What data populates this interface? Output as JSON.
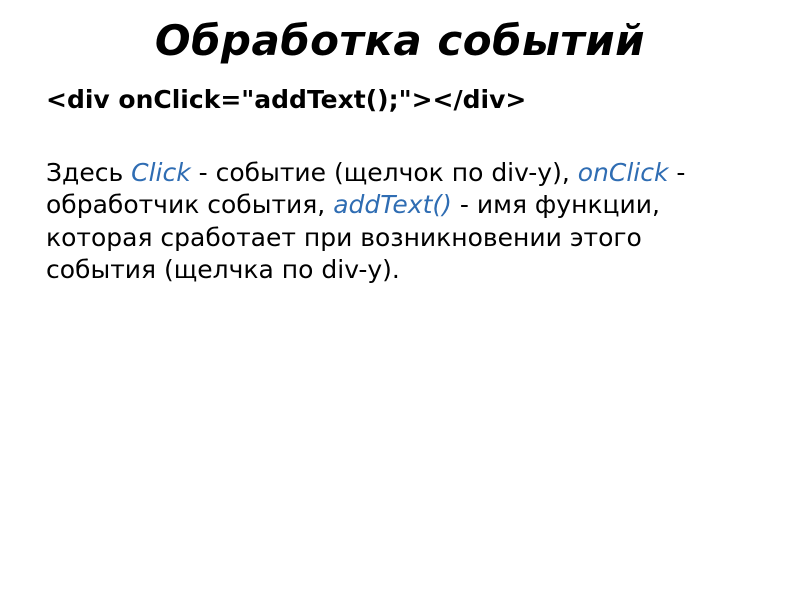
{
  "title": "Обработка событий",
  "code_line": "<div onClick=\"addText();\"></div>",
  "body": {
    "p1_before_click": "Здесь ",
    "click": "Click",
    "p1_after_click": " - событие (щелчок по div-у), ",
    "onclick": "onClick",
    "p1_after_onclick": " - обработчик события, ",
    "addtext": "addText()",
    "p1_after_addtext": " - имя функции, которая сработает при возникновении этого события (щелчка по div-у)."
  }
}
